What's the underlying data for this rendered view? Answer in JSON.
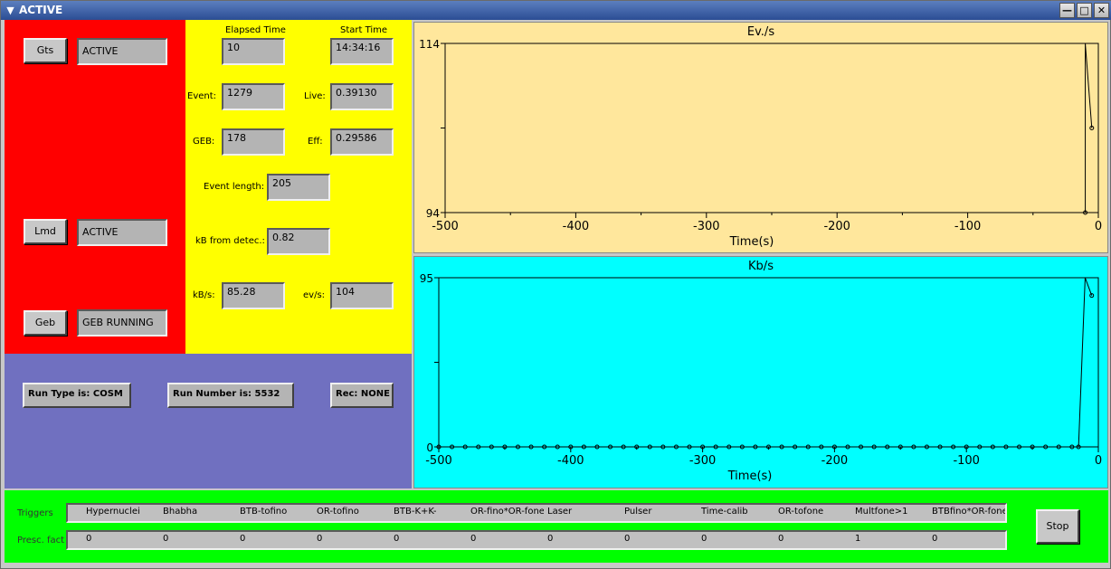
{
  "window": {
    "title": "ACTIVE"
  },
  "status": {
    "gts": {
      "label": "Gts",
      "value": "ACTIVE"
    },
    "lmd": {
      "label": "Lmd",
      "value": "ACTIVE"
    },
    "geb": {
      "label": "Geb",
      "value": "GEB RUNNING"
    }
  },
  "stats": {
    "elapsed_label": "Elapsed Time",
    "elapsed": "10",
    "start_label": "Start Time",
    "start": "14:34:16",
    "event_label": "Event:",
    "event": "1279",
    "live_label": "Live:",
    "live": "0.39130",
    "geb_label": "GEB:",
    "geb": "178",
    "eff_label": "Eff:",
    "eff": "0.29586",
    "evlen_label": "Event length:",
    "evlen": "205",
    "kbdet_label": "kB from detec.:",
    "kbdet": "0.82",
    "kbs_label": "kB/s:",
    "kbs": "85.28",
    "evs_label": "ev/s:",
    "evs": "104"
  },
  "run": {
    "type": "Run Type is: COSM",
    "number": "Run Number is: 5532",
    "rec": "Rec: NONE"
  },
  "chart_data": [
    {
      "type": "line",
      "title": "Ev./s",
      "xlabel": "Time(s)",
      "ylabel": "",
      "xlim": [
        -500,
        0
      ],
      "ylim": [
        94,
        114
      ],
      "yticks": [
        "114",
        "94"
      ],
      "xticks": [
        "-500",
        "-400",
        "-300",
        "-200",
        "-100",
        "0"
      ],
      "x": [
        -10,
        -10,
        -5
      ],
      "y": [
        94,
        114,
        104
      ]
    },
    {
      "type": "line",
      "title": "Kb/s",
      "xlabel": "Time(s)",
      "ylabel": "",
      "xlim": [
        -500,
        0
      ],
      "ylim": [
        0,
        95
      ],
      "yticks": [
        "95",
        "0"
      ],
      "xticks": [
        "-500",
        "-400",
        "-300",
        "-200",
        "-100",
        "0"
      ],
      "x": [
        -500,
        -490,
        -480,
        -470,
        -460,
        -450,
        -440,
        -430,
        -420,
        -410,
        -400,
        -390,
        -380,
        -370,
        -360,
        -350,
        -340,
        -330,
        -320,
        -310,
        -300,
        -290,
        -280,
        -270,
        -260,
        -250,
        -240,
        -230,
        -220,
        -210,
        -200,
        -190,
        -180,
        -170,
        -160,
        -150,
        -140,
        -130,
        -120,
        -110,
        -100,
        -90,
        -80,
        -70,
        -60,
        -50,
        -40,
        -30,
        -20,
        -15,
        -10,
        -5
      ],
      "y": [
        0,
        0,
        0,
        0,
        0,
        0,
        0,
        0,
        0,
        0,
        0,
        0,
        0,
        0,
        0,
        0,
        0,
        0,
        0,
        0,
        0,
        0,
        0,
        0,
        0,
        0,
        0,
        0,
        0,
        0,
        0,
        0,
        0,
        0,
        0,
        0,
        0,
        0,
        0,
        0,
        0,
        0,
        0,
        0,
        0,
        0,
        0,
        0,
        0,
        0,
        95,
        85
      ]
    }
  ],
  "triggers": {
    "label": "Triggers",
    "presc_label": "Presc. fact",
    "names": [
      "Hypernuclei",
      "Bhabha",
      "BTB-tofino",
      "OR-tofino",
      "BTB-K+K-",
      "OR-fino*OR-fone",
      "Laser",
      "Pulser",
      "Time-calib",
      "OR-tofone",
      "Multfone>1",
      "BTBfino*OR-fone"
    ],
    "factors": [
      "0",
      "0",
      "0",
      "0",
      "0",
      "0",
      "0",
      "0",
      "0",
      "0",
      "1",
      "0"
    ]
  },
  "stop_label": "Stop"
}
